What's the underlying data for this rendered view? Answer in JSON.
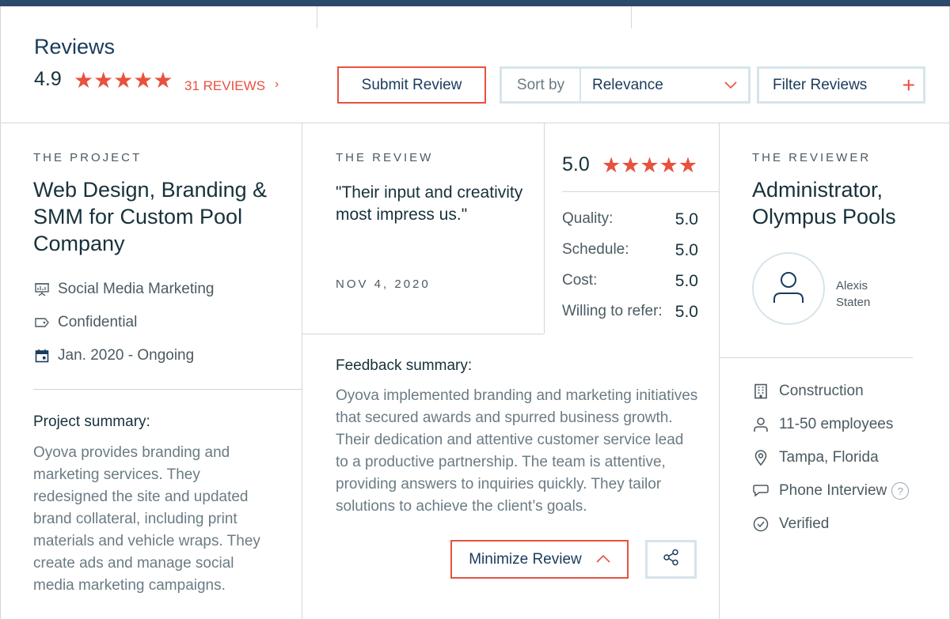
{
  "header": {
    "title": "Reviews",
    "rating": "4.9",
    "rating_stars": "★★★★★",
    "review_count": "31 REVIEWS",
    "submit_label": "Submit Review",
    "sort_label": "Sort by",
    "sort_value": "Relevance",
    "filter_label": "Filter Reviews"
  },
  "project": {
    "eyebrow": "THE PROJECT",
    "title": "Web Design, Branding & SMM for Custom Pool Company",
    "service": "Social Media Marketing",
    "budget": "Confidential",
    "dates": "Jan. 2020 - Ongoing",
    "summary_heading": "Project summary:",
    "summary": "Oyova provides branding and marketing services. They redesigned the site and updated brand collateral, including print materials and vehicle wraps. They create ads and manage social media marketing campaigns."
  },
  "review": {
    "eyebrow": "THE REVIEW",
    "quote": "\"Their input and creativity most impress us.\"",
    "date": "NOV 4, 2020",
    "overall": "5.0",
    "overall_stars": "★★★★★",
    "scores": [
      {
        "label": "Quality:",
        "value": "5.0"
      },
      {
        "label": "Schedule:",
        "value": "5.0"
      },
      {
        "label": "Cost:",
        "value": "5.0"
      },
      {
        "label": "Willing to refer:",
        "value": "5.0"
      }
    ],
    "feedback_heading": "Feedback summary:",
    "feedback": "Oyova implemented branding and marketing initiatives that secured awards and spurred business growth. Their dedication and attentive customer service lead to a productive partnership. The team is attentive, providing answers to inquiries quickly. They tailor solutions to achieve the client’s goals.",
    "minimize_label": "Minimize Review"
  },
  "reviewer": {
    "eyebrow": "THE REVIEWER",
    "title": "Administrator, Olympus Pools",
    "name": "Alexis Staten",
    "industry": "Construction",
    "size": "11-50 employees",
    "location": "Tampa, Florida",
    "interview": "Phone Interview",
    "verified": "Verified"
  },
  "colors": {
    "accent": "#e8513e",
    "navy": "#1a3b5c",
    "border": "#cfd8dc"
  }
}
